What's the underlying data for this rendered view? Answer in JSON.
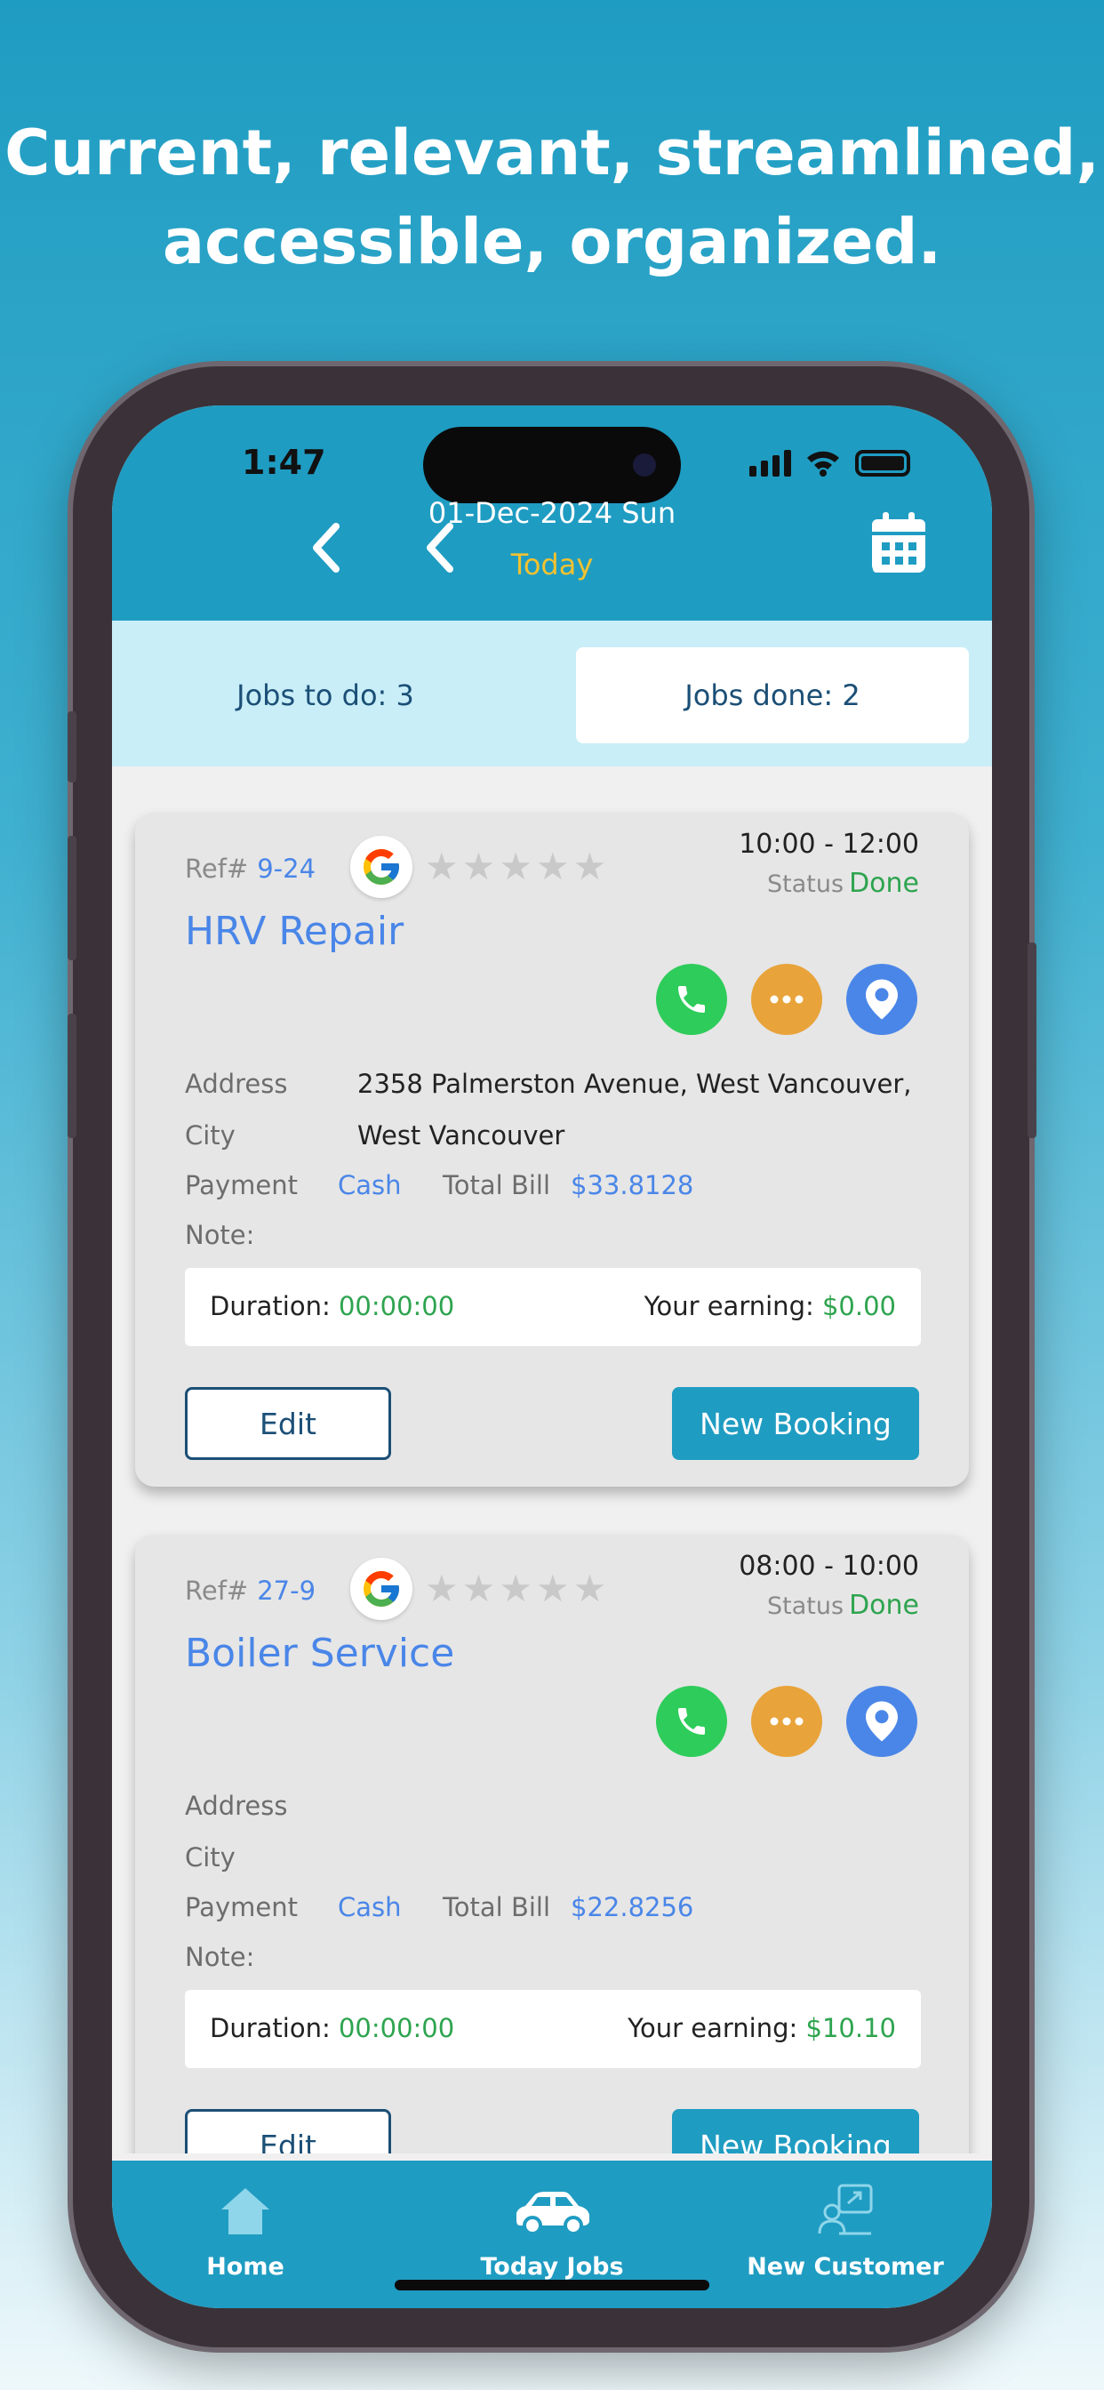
{
  "headline": {
    "line1": "Current, relevant, streamlined,",
    "line2": "accessible, organized."
  },
  "status_bar": {
    "time": "1:47"
  },
  "header": {
    "date": "01-Dec-2024 Sun",
    "today_label": "Today",
    "icons": [
      "chevron-left-icon",
      "chevron-left-icon",
      "chevron-right-icon",
      "calendar-icon"
    ]
  },
  "tabs": {
    "todo": "Jobs to do: 3",
    "done": "Jobs done: 2",
    "active": "done"
  },
  "jobs": [
    {
      "ref_label": "Ref#",
      "ref": "9-24",
      "time": "10:00 - 12:00",
      "status_label": "Status",
      "status": "Done",
      "title": "HRV Repair",
      "address_label": "Address",
      "address": "2358 Palmerston Avenue, West Vancouver,",
      "city_label": "City",
      "city": "West Vancouver",
      "payment_label": "Payment",
      "payment": "Cash",
      "total_label": "Total Bill",
      "total": "$33.8128",
      "note_label": "Note:",
      "duration_label": "Duration:",
      "duration": "00:00:00",
      "earning_label": "Your earning:",
      "earning": "$0.00",
      "edit_label": "Edit",
      "new_booking_label": "New Booking",
      "rating": 0
    },
    {
      "ref_label": "Ref#",
      "ref": "27-9",
      "time": "08:00 - 10:00",
      "status_label": "Status",
      "status": "Done",
      "title": "Boiler Service",
      "address_label": "Address",
      "address": "",
      "city_label": "City",
      "city": "",
      "payment_label": "Payment",
      "payment": "Cash",
      "total_label": "Total Bill",
      "total": "$22.8256",
      "note_label": "Note:",
      "duration_label": "Duration:",
      "duration": "00:00:00",
      "earning_label": "Your earning:",
      "earning": "$10.10",
      "edit_label": "Edit",
      "new_booking_label": "New Booking",
      "rating": 0
    }
  ],
  "bottom_nav": [
    {
      "label": "Home",
      "icon": "home-icon"
    },
    {
      "label": "Today Jobs",
      "icon": "car-icon"
    },
    {
      "label": "New Customer",
      "icon": "add-customer-icon"
    }
  ],
  "colors": {
    "brand": "#1f9cc2",
    "tab_bar": "#c9eef8",
    "accent_blue": "#4a86e8",
    "today_yellow": "#f2c230",
    "done_green": "#2ea44f",
    "call_green": "#2ecc5a",
    "chat_orange": "#e8a33a"
  }
}
